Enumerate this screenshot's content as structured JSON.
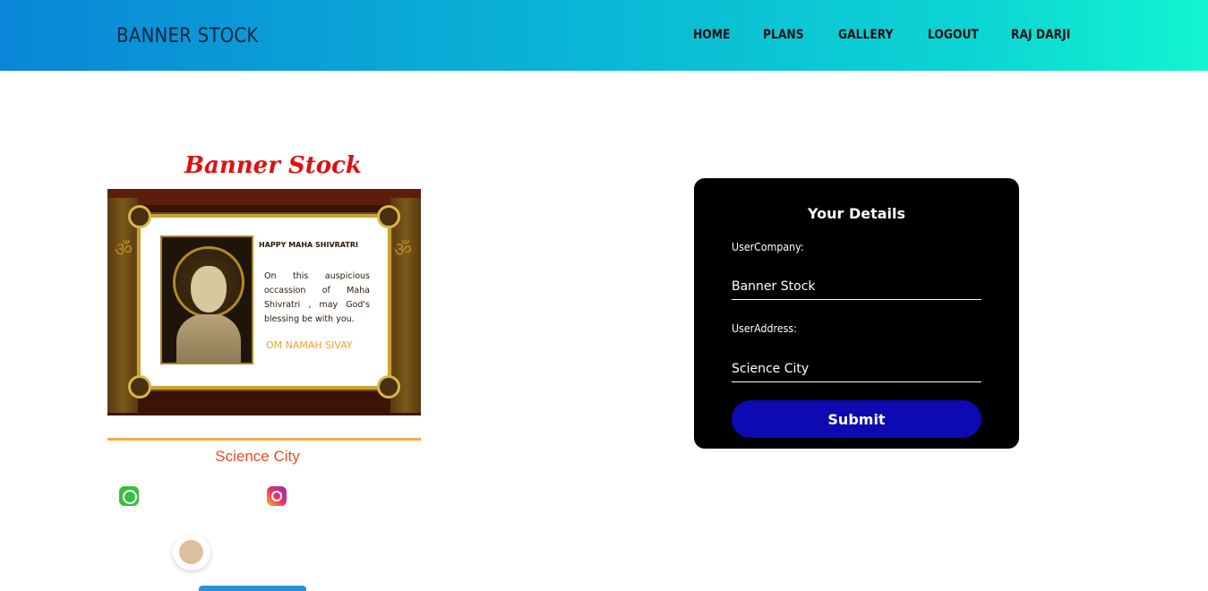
{
  "header": {
    "brand": "BANNER STOCK",
    "nav": [
      "HOME",
      "PLANS",
      "GALLERY",
      "LOGOUT",
      "RAJ DARJI"
    ]
  },
  "banner": {
    "title": "Banner Stock",
    "greeting_heading": "HAPPY MAHA SHIVRATRI",
    "greeting_body": "On this auspicious occassion of Maha Shivratri , may God's blessing be with you.",
    "greeting_footer": "OM NAMAH SIVAY",
    "address": "Science City",
    "icons": [
      "whatsapp-icon",
      "instagram-icon"
    ]
  },
  "form": {
    "title": "Your Details",
    "company_label": "UserCompany:",
    "company_value": "Banner Stock",
    "address_label": "UserAddress:",
    "address_value": "Science City",
    "submit_label": "Submit"
  },
  "colors": {
    "header_gradient_start": "#0a86d8",
    "header_gradient_end": "#12f5d0",
    "card_bg": "#000000",
    "submit_bg": "#0c0ab0",
    "banner_title": "#e01010",
    "banner_address": "#f04b24"
  }
}
